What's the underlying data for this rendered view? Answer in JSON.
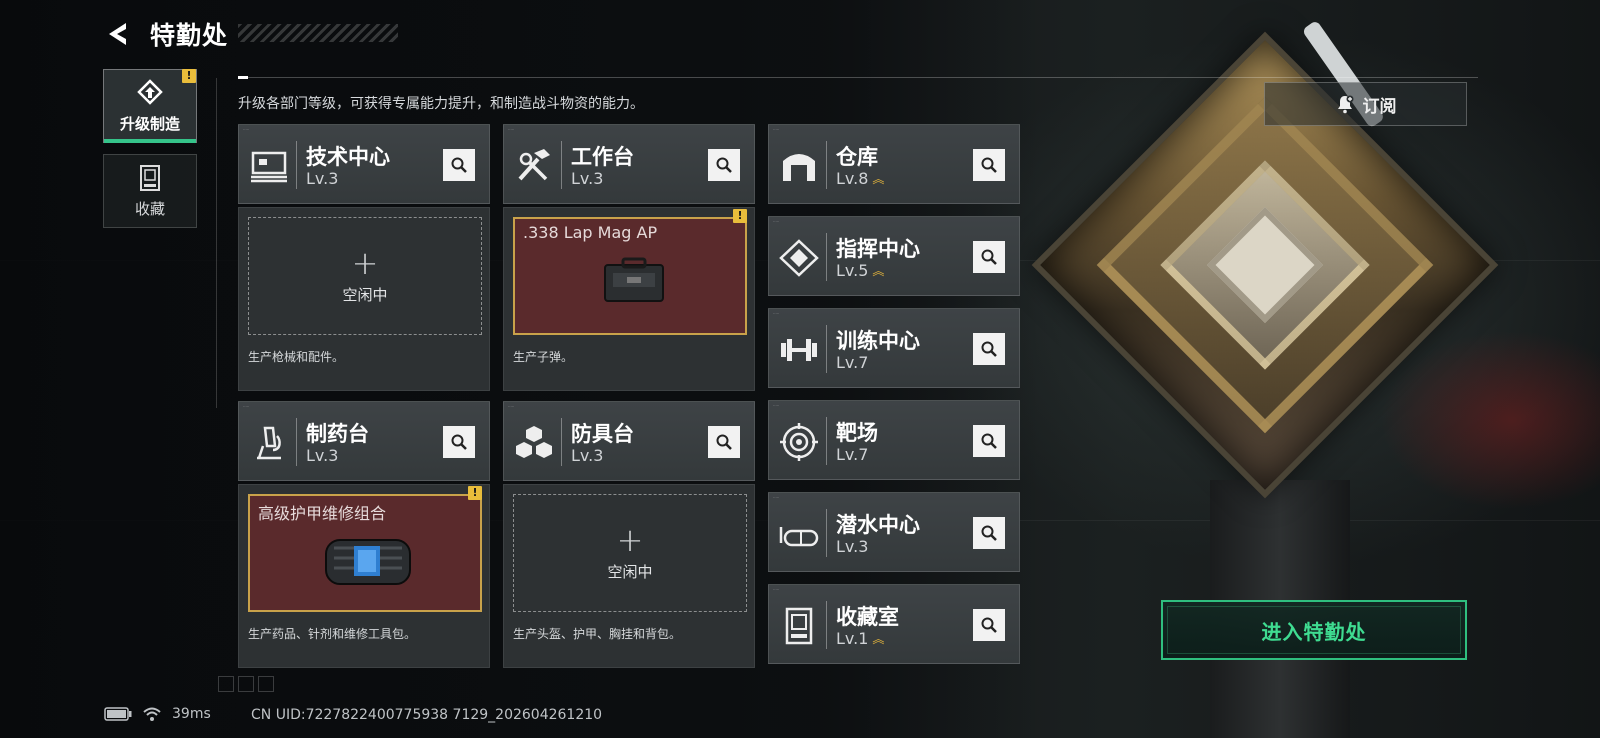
{
  "header": {
    "title": "特勤处",
    "subtitle": "升级各部门等级，可获得专属能力提升，和制造战斗物资的能力。"
  },
  "side_tabs": [
    {
      "label": "升级制造",
      "icon": "upgrade-craft-icon",
      "active": true,
      "warning": "!"
    },
    {
      "label": "收藏",
      "icon": "collection-icon",
      "active": false
    }
  ],
  "subscribe": {
    "label": "订阅",
    "icon": "bell-plus-icon"
  },
  "facilities": {
    "tech_center": {
      "name": "技术中心",
      "level": "Lv.3",
      "icon": "tech-center-icon"
    },
    "workbench": {
      "name": "工作台",
      "level": "Lv.3",
      "icon": "tools-icon"
    },
    "pharmacy": {
      "name": "制药台",
      "level": "Lv.3",
      "icon": "microscope-icon"
    },
    "armor_bench": {
      "name": "防具台",
      "level": "Lv.3",
      "icon": "cubes-icon"
    },
    "warehouse": {
      "name": "仓库",
      "level": "Lv.8",
      "icon": "warehouse-icon",
      "upgradeable": true
    },
    "command": {
      "name": "指挥中心",
      "level": "Lv.5",
      "icon": "command-icon",
      "upgradeable": true
    },
    "training": {
      "name": "训练中心",
      "level": "Lv.7",
      "icon": "dumbbell-icon"
    },
    "range": {
      "name": "靶场",
      "level": "Lv.7",
      "icon": "target-icon"
    },
    "diving": {
      "name": "潜水中心",
      "level": "Lv.3",
      "icon": "goggles-icon"
    },
    "collection_room": {
      "name": "收藏室",
      "level": "Lv.1",
      "icon": "trophy-case-icon",
      "upgradeable": true
    }
  },
  "production": {
    "tech_center": {
      "status": "空闲中",
      "desc": "生产枪械和配件。"
    },
    "workbench": {
      "item": ".338 Lap Mag AP",
      "desc": "生产子弹。",
      "warning": "!"
    },
    "pharmacy": {
      "item": "高级护甲维修组合",
      "desc": "生产药品、针剂和维修工具包。",
      "warning": "!"
    },
    "armor_bench": {
      "status": "空闲中",
      "desc": "生产头盔、护甲、胸挂和背包。"
    }
  },
  "enter_button": {
    "label": "进入特勤处"
  },
  "status": {
    "ping": "39ms",
    "uid": "CN UID:7227822400775938 7129_202604261210"
  },
  "colors": {
    "accent": "#35c48a",
    "warning": "#e9bd3b",
    "busy_slot": "#5a2a2c",
    "busy_border": "#c9a24a"
  }
}
